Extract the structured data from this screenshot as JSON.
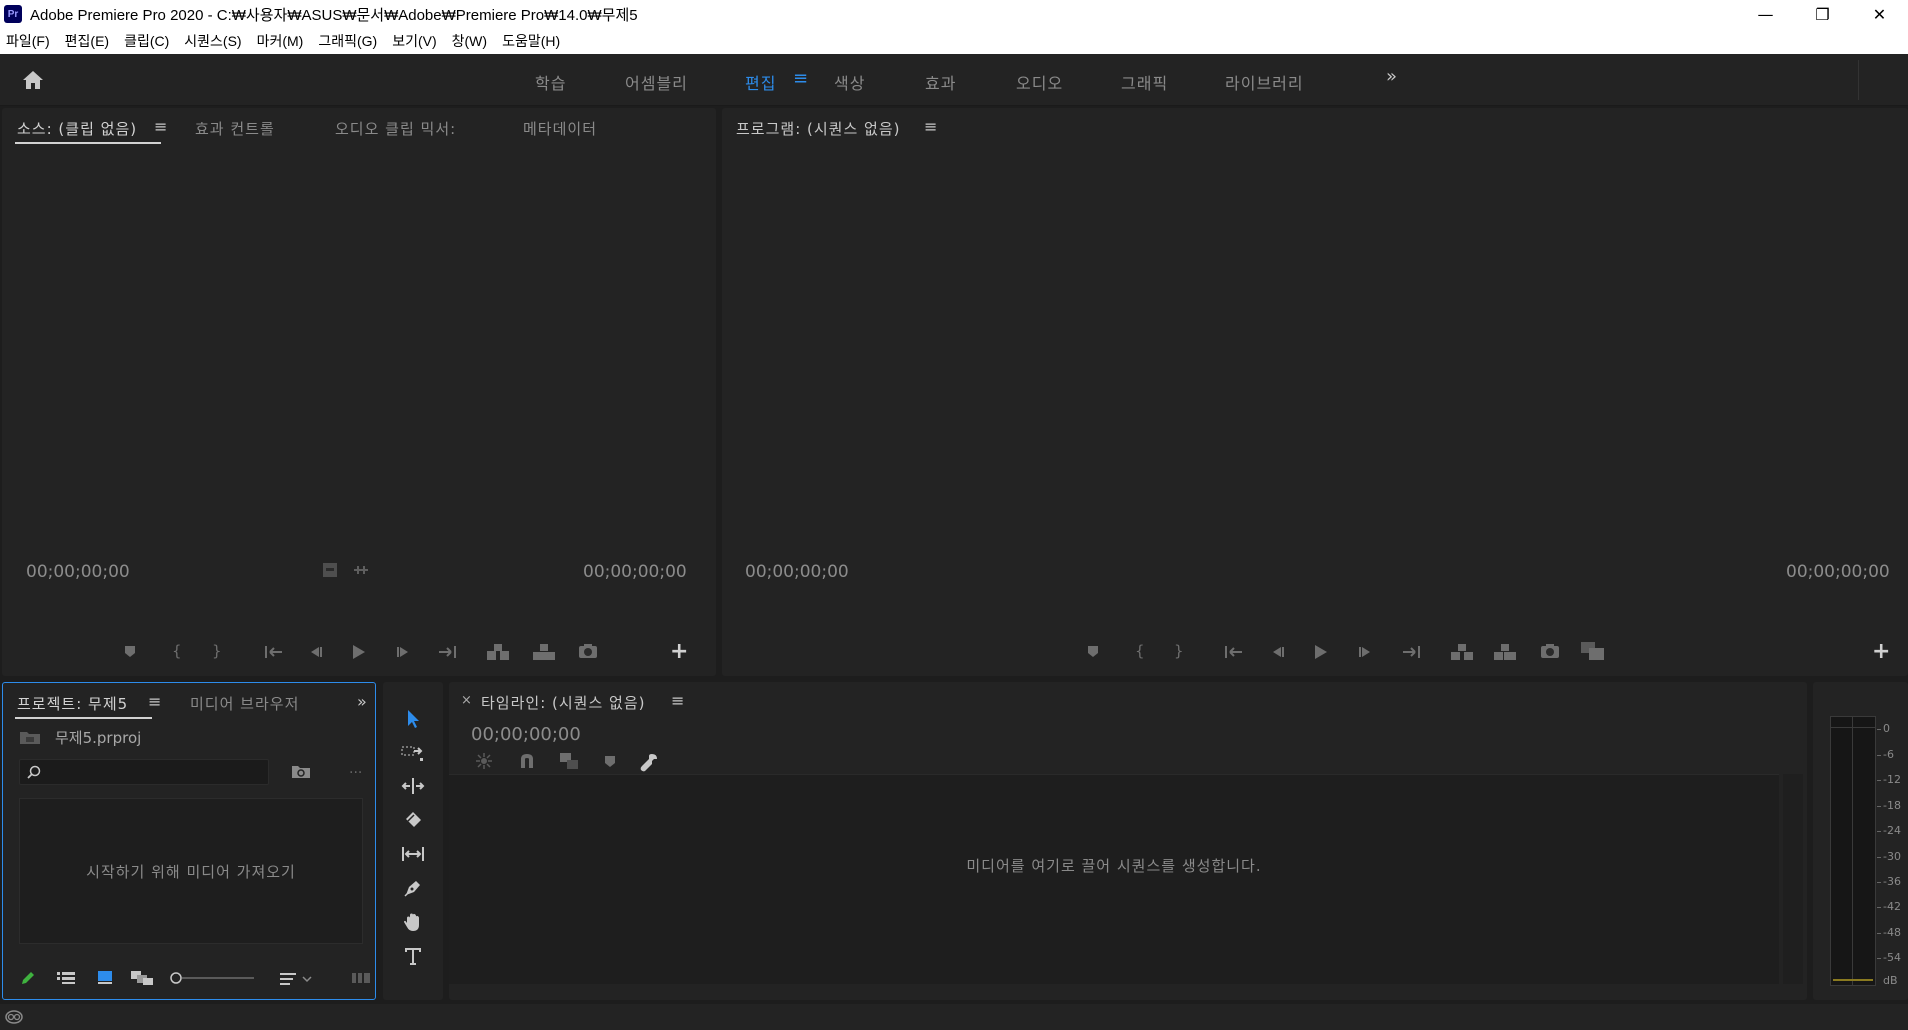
{
  "window": {
    "app_badge": "Pr",
    "title": "Adobe Premiere Pro 2020 - C:₩사용자₩ASUS₩문서₩Adobe₩Premiere Pro₩14.0₩무제5",
    "minimize": "—",
    "restore": "❐",
    "close": "✕"
  },
  "menu": [
    "파일(F)",
    "편집(E)",
    "클립(C)",
    "시퀀스(S)",
    "마커(M)",
    "그래픽(G)",
    "보기(V)",
    "창(W)",
    "도움말(H)"
  ],
  "workspaces": {
    "tabs": [
      "학습",
      "어셈블리",
      "편집",
      "색상",
      "효과",
      "오디오",
      "그래픽",
      "라이브러리"
    ],
    "active": "편집",
    "more": "»",
    "menu_glyph": "≡"
  },
  "source_panel": {
    "tabs": [
      "소스: (클립 없음)",
      "효과 컨트롤",
      "오디오 클립 믹서:",
      "메타데이터"
    ],
    "menu_glyph": "≡",
    "timecode_left": "00;00;00;00",
    "timecode_right": "00;00;00;00",
    "add_glyph": "+"
  },
  "program_panel": {
    "tab": "프로그램: (시퀀스 없음)",
    "menu_glyph": "≡",
    "timecode_left": "00;00;00;00",
    "timecode_right": "00;00;00;00",
    "add_glyph": "+"
  },
  "project_panel": {
    "tabs": [
      "프로젝트: 무제5",
      "미디어 브라우저"
    ],
    "menu_glyph": "≡",
    "more": "»",
    "filename": "무제5.prproj",
    "search_placeholder": "",
    "dots": "...",
    "empty_message": "시작하기 위해 미디어 가져오기"
  },
  "timeline_panel": {
    "close": "×",
    "tab": "타임라인: (시퀀스 없음)",
    "menu_glyph": "≡",
    "timecode": "00;00;00;00",
    "empty_message": "미디어를 여기로 끌어 시퀀스를 생성합니다."
  },
  "audio_meter": {
    "scale": [
      "0",
      "-6",
      "-12",
      "-18",
      "-24",
      "-30",
      "-36",
      "-42",
      "-48",
      "-54",
      "dB"
    ]
  },
  "colors": {
    "accent": "#2d8ceb",
    "panel_bg": "#232323",
    "frame_bg": "#1d1d1d"
  }
}
